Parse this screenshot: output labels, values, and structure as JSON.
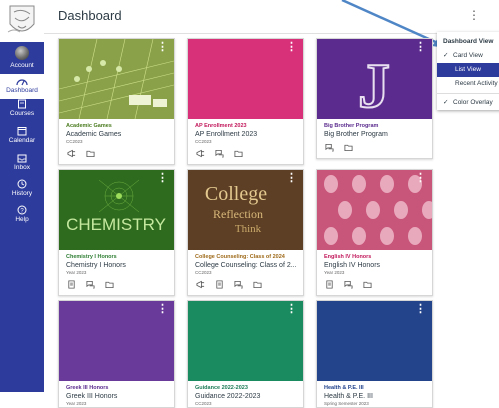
{
  "header": {
    "title": "Dashboard"
  },
  "nav": [
    {
      "key": "account",
      "label": "Account"
    },
    {
      "key": "dashboard",
      "label": "Dashboard"
    },
    {
      "key": "courses",
      "label": "Courses"
    },
    {
      "key": "calendar",
      "label": "Calendar"
    },
    {
      "key": "inbox",
      "label": "Inbox"
    },
    {
      "key": "history",
      "label": "History"
    },
    {
      "key": "help",
      "label": "Help"
    }
  ],
  "menu": {
    "title": "Dashboard View",
    "items": [
      "Card View",
      "List View",
      "Recent Activity",
      "Color Overlay"
    ]
  },
  "cards": [
    {
      "nickname": "Academic Games",
      "name": "Academic Games",
      "term": "CC2023",
      "nick_color": "#4a7b1f",
      "hero_color": "#8aa14a"
    },
    {
      "nickname": "AP Enrollment 2023",
      "name": "AP Enrollment 2023",
      "term": "CC2023",
      "nick_color": "#c2185b",
      "hero_color": "#d8317a"
    },
    {
      "nickname": "Big Brother Program",
      "name": "Big Brother Program",
      "term": "",
      "nick_color": "#5b2c8e",
      "hero_color": "#5b2c8e"
    },
    {
      "nickname": "Chemistry I Honors",
      "name": "Chemistry I Honors",
      "term": "Year 2023",
      "nick_color": "#2e7d32",
      "hero_color": "#2e6b1e"
    },
    {
      "nickname": "College Counseling: Class of 2024",
      "name": "College Counseling: Class of 2...",
      "term": "CC2023",
      "nick_color": "#9e6a1a",
      "hero_color": "#6b4a2a"
    },
    {
      "nickname": "English IV Honors",
      "name": "English IV Honors",
      "term": "Year 2023",
      "nick_color": "#c2185b",
      "hero_color": "#c8557a"
    },
    {
      "nickname": "Greek III Honors",
      "name": "Greek III Honors",
      "term": "Year 2023",
      "nick_color": "#5b2c8e",
      "hero_color": "#6a3a9a"
    },
    {
      "nickname": "Guidance 2022-2023",
      "name": "Guidance 2022-2023",
      "term": "CC2023",
      "nick_color": "#1b7a56",
      "hero_color": "#1a8a60"
    },
    {
      "nickname": "Health & P.E. III",
      "name": "Health & P.E. III",
      "term": "Spring Semester 2023",
      "nick_color": "#1e3f8a",
      "hero_color": "#23448a"
    }
  ],
  "hero_text": {
    "chemistry": "CHEMISTRY",
    "college_1": "College",
    "college_2": "Reflection",
    "college_3": "Think",
    "big_j": "J"
  }
}
